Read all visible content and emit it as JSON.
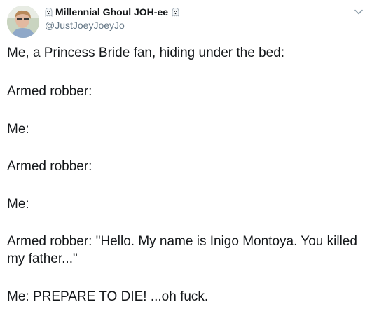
{
  "author": {
    "display_name": "Millennial Ghoul JOH-ee",
    "handle": "@JustJoeyJoeyJo",
    "name_prefix_emoji": "ghost-icon",
    "name_suffix_emoji": "ghost-icon"
  },
  "tweet": {
    "lines": [
      "Me, a Princess Bride fan, hiding under the bed:",
      "Armed robber:",
      "Me:",
      "Armed robber:",
      "Me:",
      "Armed robber: \"Hello. My name is Inigo Montoya. You killed my father...\"",
      "Me: PREPARE TO DIE! ...oh fuck."
    ]
  },
  "menu": {
    "icon": "chevron-down-icon"
  },
  "colors": {
    "text": "#14171a",
    "secondary_text": "#657786",
    "background": "#ffffff"
  }
}
